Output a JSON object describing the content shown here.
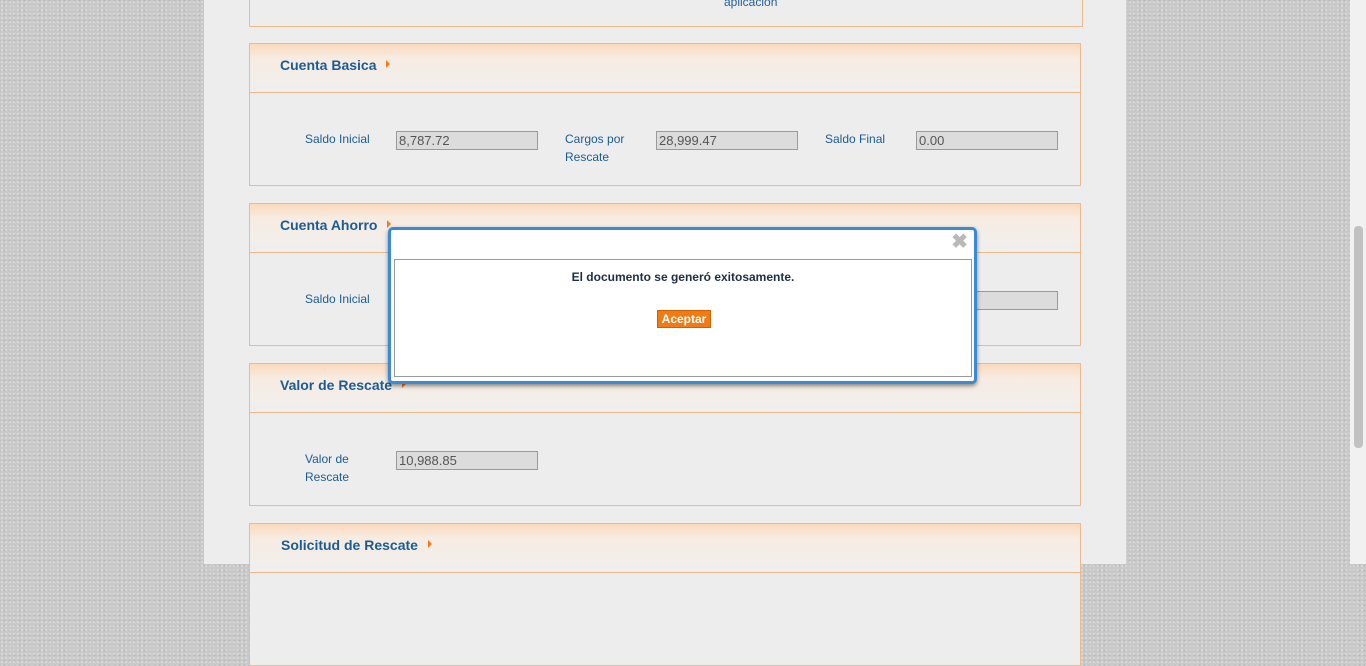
{
  "top_fragment": "aplicación",
  "sections": {
    "cuenta_basica": {
      "title": "Cuenta Basica",
      "saldo_inicial_label": "Saldo Inicial",
      "saldo_inicial_value": "8,787.72",
      "cargos_label": "Cargos por Rescate",
      "cargos_value": "28,999.47",
      "saldo_final_label": "Saldo Final",
      "saldo_final_value": "0.00"
    },
    "cuenta_ahorro": {
      "title": "Cuenta Ahorro",
      "saldo_inicial_label": "Saldo Inicial"
    },
    "valor_rescate": {
      "title": "Valor de Rescate",
      "valor_label": "Valor de Rescate",
      "valor_value": "10,988.85"
    },
    "solicitud_rescate": {
      "title": "Solicitud de Rescate"
    }
  },
  "modal": {
    "message": "El documento se generó exitosamente.",
    "accept_label": "Aceptar",
    "close_glyph": "✖"
  },
  "colors": {
    "accent_blue": "#1a5c94",
    "accent_orange": "#f07b14",
    "section_border": "#f1b98a"
  }
}
